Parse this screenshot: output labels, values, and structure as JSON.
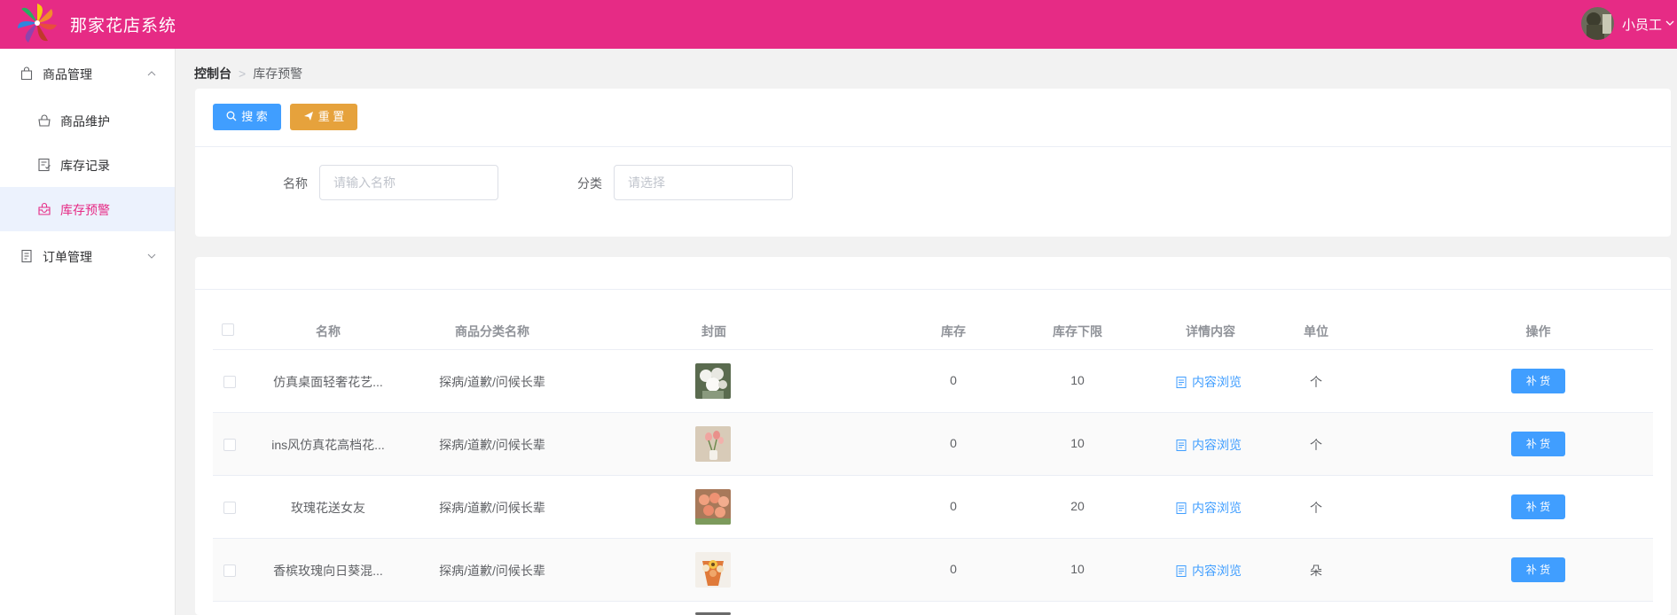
{
  "header": {
    "app_title": "那家花店系统",
    "user_name": "小员工",
    "brand_color": "#e62b85"
  },
  "sidebar": {
    "groups": [
      {
        "label": "商品管理",
        "icon": "shopping-bag-icon",
        "expanded": true,
        "items": [
          {
            "label": "商品维护",
            "icon": "goods-icon",
            "active": false
          },
          {
            "label": "库存记录",
            "icon": "record-icon",
            "active": false
          },
          {
            "label": "库存预警",
            "icon": "alert-box-icon",
            "active": true
          }
        ]
      },
      {
        "label": "订单管理",
        "icon": "document-icon",
        "expanded": false,
        "items": []
      }
    ]
  },
  "breadcrumb": {
    "home": "控制台",
    "current": "库存预警"
  },
  "search": {
    "search_button": "搜 索",
    "reset_button": "重 置",
    "name_label": "名称",
    "name_placeholder": "请输入名称",
    "category_label": "分类",
    "category_placeholder": "请选择"
  },
  "table": {
    "columns": [
      "名称",
      "商品分类名称",
      "封面",
      "库存",
      "库存下限",
      "详情内容",
      "单位",
      "操作"
    ],
    "rows": [
      {
        "name": "仿真桌面轻奢花艺...",
        "category": "探病/道歉/问候长辈",
        "stock": "0",
        "min_stock": "10",
        "detail": "内容浏览",
        "unit": "个",
        "action": "补 货"
      },
      {
        "name": "ins风仿真花高档花...",
        "category": "探病/道歉/问候长辈",
        "stock": "0",
        "min_stock": "10",
        "detail": "内容浏览",
        "unit": "个",
        "action": "补 货"
      },
      {
        "name": "玫瑰花送女友",
        "category": "探病/道歉/问候长辈",
        "stock": "0",
        "min_stock": "20",
        "detail": "内容浏览",
        "unit": "个",
        "action": "补 货"
      },
      {
        "name": "香槟玫瑰向日葵混...",
        "category": "探病/道歉/问候长辈",
        "stock": "0",
        "min_stock": "10",
        "detail": "内容浏览",
        "unit": "朵",
        "action": "补 货"
      }
    ]
  },
  "colors": {
    "primary": "#409eff",
    "warning": "#e6a23c",
    "active_menu_bg": "#ecf2fd"
  }
}
